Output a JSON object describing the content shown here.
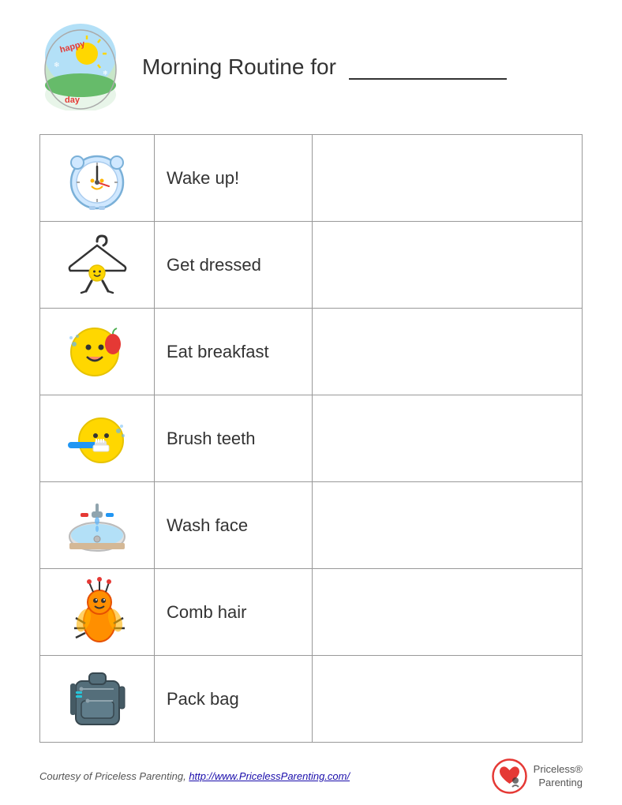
{
  "header": {
    "title": "Morning Routine for",
    "title_line": "___________________"
  },
  "table": {
    "rows": [
      {
        "id": "wake-up",
        "label": "Wake up!",
        "icon_type": "clock"
      },
      {
        "id": "get-dressed",
        "label": "Get dressed",
        "icon_type": "hanger"
      },
      {
        "id": "eat-breakfast",
        "label": "Eat breakfast",
        "icon_type": "breakfast"
      },
      {
        "id": "brush-teeth",
        "label": "Brush teeth",
        "icon_type": "brush"
      },
      {
        "id": "wash-face",
        "label": "Wash face",
        "icon_type": "wash"
      },
      {
        "id": "comb-hair",
        "label": "Comb hair",
        "icon_type": "comb"
      },
      {
        "id": "pack-bag",
        "label": "Pack bag",
        "icon_type": "bag"
      }
    ]
  },
  "footer": {
    "courtesy_text": "Courtesy of Priceless Parenting,",
    "link_text": "http://www.PricelessParenting.com/",
    "brand_name": "Priceless®",
    "brand_sub": "Parenting"
  }
}
